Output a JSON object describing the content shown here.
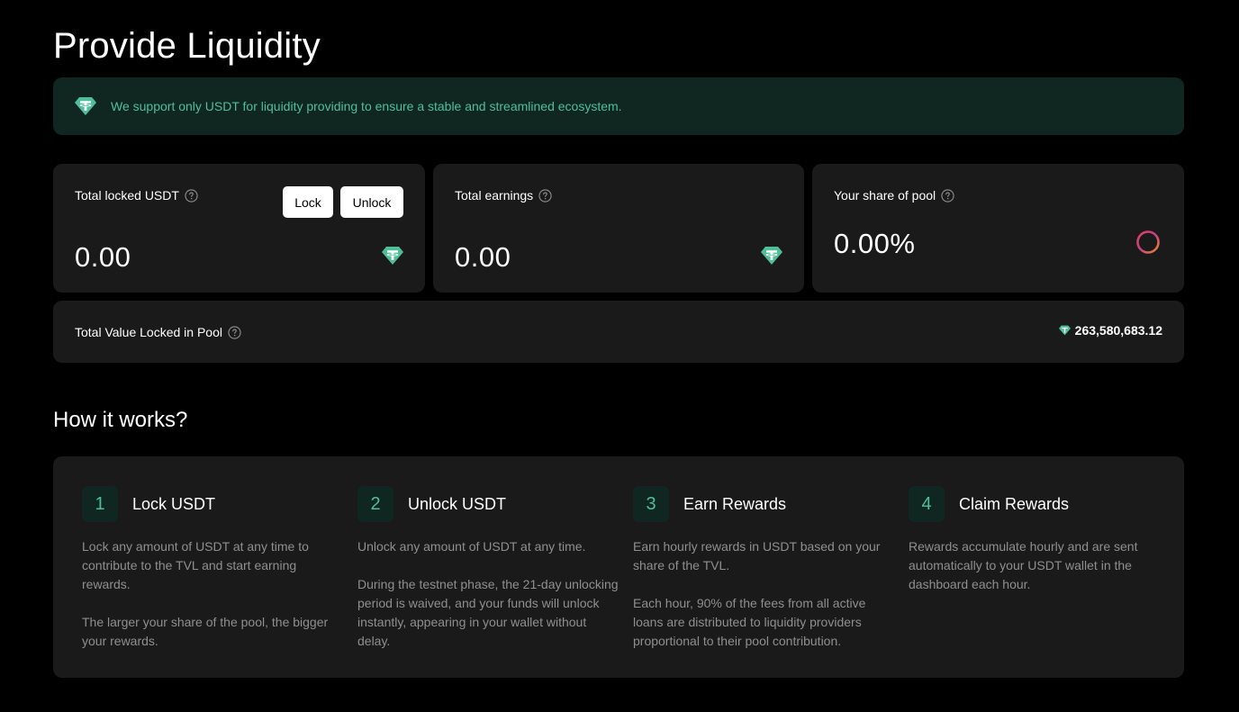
{
  "page": {
    "title": "Provide Liquidity"
  },
  "notice": {
    "icon": "tether-icon",
    "text": "We support only USDT for liquidity providing to ensure a stable and streamlined ecosystem."
  },
  "stats": {
    "locked": {
      "label": "Total locked USDT",
      "value": "0.00",
      "lock_label": "Lock",
      "unlock_label": "Unlock"
    },
    "earnings": {
      "label": "Total earnings",
      "value": "0.00"
    },
    "share": {
      "label": "Your share of pool",
      "value": "0.00%"
    },
    "tvl": {
      "label": "Total Value Locked in Pool",
      "value": "263,580,683.12"
    }
  },
  "how": {
    "title": "How it works?",
    "steps": [
      {
        "num": "1",
        "title": "Lock USDT",
        "p1": "Lock any amount of USDT at any time to contribute to the TVL and start earning rewards.",
        "p2": "The larger your share of the pool, the bigger your rewards."
      },
      {
        "num": "2",
        "title": "Unlock USDT",
        "p1": "Unlock any amount of USDT at any time.",
        "p2": "During the testnet phase, the 21-day unlocking period is waived, and your funds will unlock instantly, appearing in your wallet without delay."
      },
      {
        "num": "3",
        "title": "Earn Rewards",
        "p1": "Earn hourly rewards in USDT based on your share of the TVL.",
        "p2": "Each hour, 90% of the fees from all active loans are distributed to liquidity providers proportional to their pool contribution."
      },
      {
        "num": "4",
        "title": "Claim Rewards",
        "p1": "Rewards accumulate hourly and are sent automatically to your USDT wallet in the dashboard each hour.",
        "p2": ""
      }
    ]
  },
  "colors": {
    "background": "#000000",
    "card": "#1a1a1a",
    "accent": "#4fbf9a",
    "accent_bg": "#0f2621",
    "muted_text": "#8f8f8f"
  }
}
